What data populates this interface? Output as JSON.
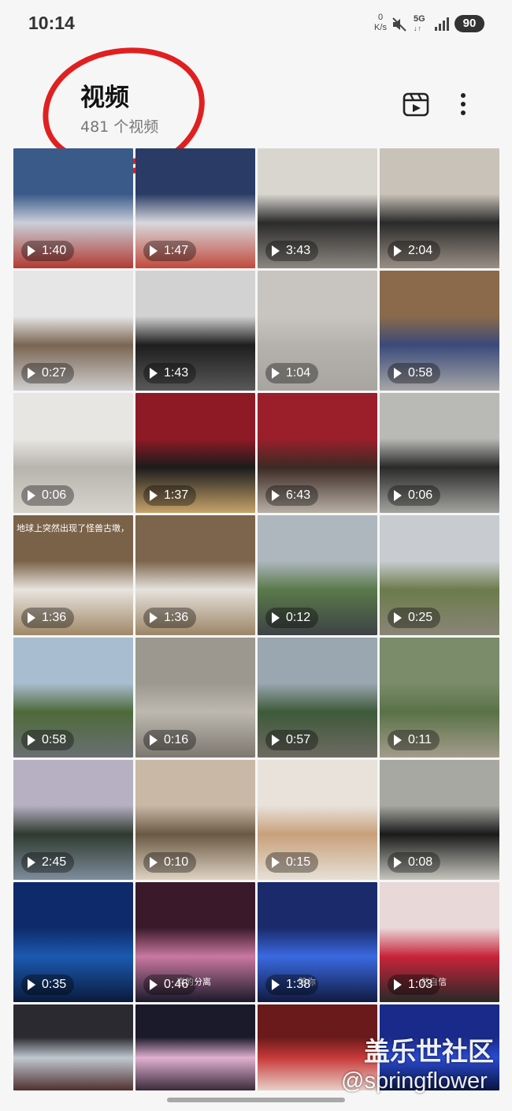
{
  "status_bar": {
    "time": "10:14",
    "net_speed_value": "0",
    "net_speed_unit": "K/s",
    "network_type": "5G",
    "battery": "90"
  },
  "header": {
    "title": "视频",
    "subtitle": "481 个视频",
    "clips_icon": "clapperboard-icon",
    "more_icon": "more-vertical-icon",
    "annotation_color": "#e02020"
  },
  "videos": [
    {
      "duration": "1:40",
      "colors": [
        "#3a5a8a",
        "#c9cfd8",
        "#b23a32"
      ]
    },
    {
      "duration": "1:47",
      "colors": [
        "#2a3c66",
        "#d8d8dc",
        "#c14a3c"
      ]
    },
    {
      "duration": "3:43",
      "colors": [
        "#d9d6d0",
        "#2b2b2b",
        "#8b8780"
      ]
    },
    {
      "duration": "2:04",
      "colors": [
        "#c9c2b8",
        "#2a2a2a",
        "#9a8f85"
      ]
    },
    {
      "duration": "0:27",
      "colors": [
        "#e6e6e6",
        "#7a6553",
        "#cfcfcf"
      ]
    },
    {
      "duration": "1:43",
      "colors": [
        "#d2d2d2",
        "#1e1e1e",
        "#585858"
      ]
    },
    {
      "duration": "1:04",
      "colors": [
        "#c8c5c1",
        "#b5b2ae",
        "#a8a5a0"
      ]
    },
    {
      "duration": "0:58",
      "colors": [
        "#8a6a4a",
        "#3a4a7a",
        "#a7a7a7"
      ]
    },
    {
      "duration": "0:06",
      "colors": [
        "#e8e6e2",
        "#b8b4ae",
        "#d6d2cc"
      ]
    },
    {
      "duration": "1:37",
      "colors": [
        "#8e1a26",
        "#1b1b1b",
        "#c7a46a"
      ]
    },
    {
      "duration": "6:43",
      "colors": [
        "#9a1f2a",
        "#3b2a24",
        "#b8b0a6"
      ]
    },
    {
      "duration": "0:06",
      "colors": [
        "#b9b9b6",
        "#2a2a2a",
        "#a3a39f"
      ]
    },
    {
      "duration": "1:36",
      "colors": [
        "#7a6248",
        "#e8e4de",
        "#a08868"
      ],
      "caption": "地球上突然出现了怪兽古墩，"
    },
    {
      "duration": "1:36",
      "colors": [
        "#7c654c",
        "#e6e2dc",
        "#9c8566"
      ]
    },
    {
      "duration": "0:12",
      "colors": [
        "#aeb7be",
        "#5a7a4a",
        "#3e4246"
      ]
    },
    {
      "duration": "0:25",
      "colors": [
        "#c8ccd0",
        "#6b7c4c",
        "#8a8577"
      ]
    },
    {
      "duration": "0:58",
      "colors": [
        "#a8bdd0",
        "#4e6a3a",
        "#6a6f74"
      ]
    },
    {
      "duration": "0:16",
      "colors": [
        "#9c9890",
        "#bdb8b0",
        "#7c7870"
      ]
    },
    {
      "duration": "0:57",
      "colors": [
        "#9aa6b0",
        "#3e5a3a",
        "#6e6a62"
      ]
    },
    {
      "duration": "0:11",
      "colors": [
        "#7a8c6a",
        "#5a7248",
        "#a49c8c"
      ]
    },
    {
      "duration": "2:45",
      "colors": [
        "#b6b0c2",
        "#2f3a2f",
        "#7e8c9c"
      ]
    },
    {
      "duration": "0:10",
      "colors": [
        "#c9b8a6",
        "#6a5a44",
        "#e0d2c2"
      ]
    },
    {
      "duration": "0:15",
      "colors": [
        "#e8e2da",
        "#c8a07a",
        "#e6e0d6"
      ]
    },
    {
      "duration": "0:08",
      "colors": [
        "#a8a8a2",
        "#1a1a1a",
        "#c6c6be"
      ]
    },
    {
      "duration": "0:35",
      "colors": [
        "#0f2a6a",
        "#1b5ab0",
        "#0a1a3a"
      ]
    },
    {
      "duration": "0:46",
      "colors": [
        "#3a1a2a",
        "#c878a0",
        "#1a1a2a"
      ],
      "caption": "真的分离"
    },
    {
      "duration": "1:38",
      "colors": [
        "#1a2a6a",
        "#3a6ae0",
        "#101a40"
      ],
      "caption": "陪你"
    },
    {
      "duration": "1:03",
      "colors": [
        "#e8d8d8",
        "#c8243a",
        "#282828"
      ],
      "caption": "然自信"
    },
    {
      "duration": "",
      "colors": [
        "#2a2a30",
        "#c0c8d0",
        "#503030"
      ]
    },
    {
      "duration": "",
      "colors": [
        "#1a1a2a",
        "#e0b0d0",
        "#3a2a3a"
      ]
    },
    {
      "duration": "",
      "colors": [
        "#6a1a1a",
        "#c83a3a",
        "#e8d0c8"
      ]
    },
    {
      "duration": "",
      "colors": [
        "#1a2a8a",
        "#2a4ad0",
        "#0a1440"
      ]
    }
  ],
  "watermark": {
    "site": "盖乐世社区",
    "user": "@springflower"
  }
}
